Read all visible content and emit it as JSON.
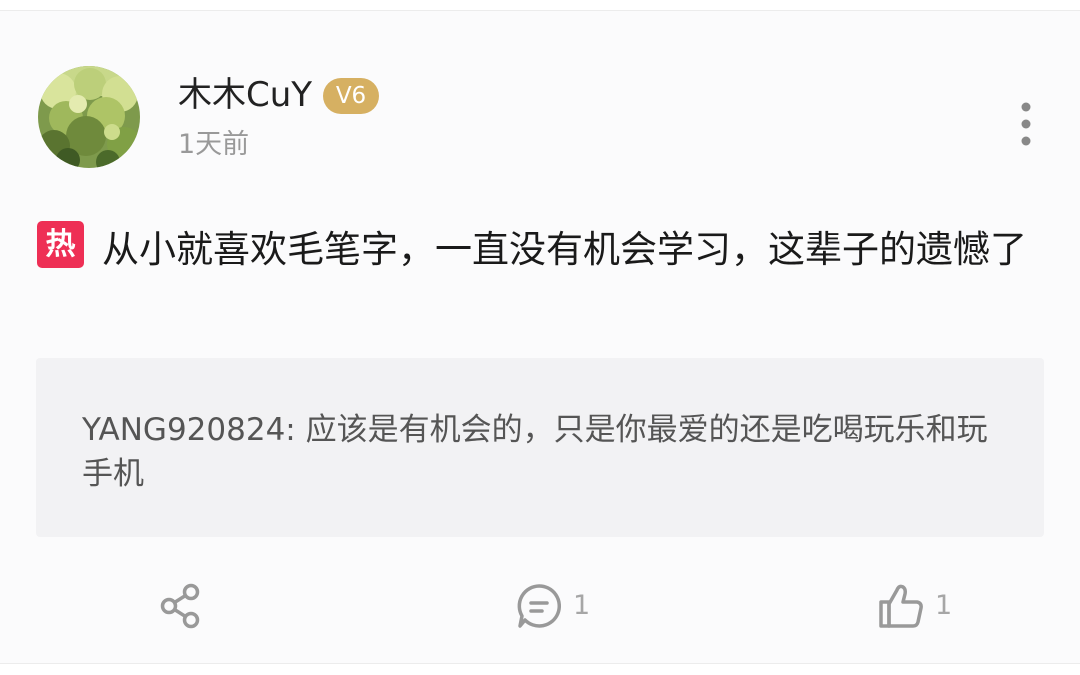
{
  "post": {
    "username": "木木CuY",
    "vip_level": "V6",
    "time": "1天前",
    "hot_tag": "热",
    "content": "从小就喜欢毛笔字，一直没有机会学习，这辈子的遗憾了"
  },
  "reply": {
    "text": "YANG920824: 应该是有机会的，只是你最爱的还是吃喝玩乐和玩手机"
  },
  "actions": {
    "share_icon": "share-icon",
    "comment_icon": "comment-icon",
    "comment_count": "1",
    "like_icon": "thumbs-up-icon",
    "like_count": "1"
  },
  "colors": {
    "hot_tag": "#ee2f55",
    "vip_badge": "#d6b062",
    "icon": "#999999"
  }
}
